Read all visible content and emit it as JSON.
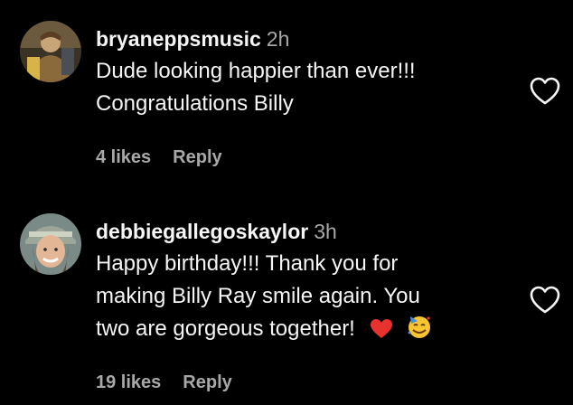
{
  "comments": [
    {
      "username": "bryaneppsmusic",
      "time": "2h",
      "lines": [
        "Dude looking happier than ever!!!",
        "Congratulations Billy"
      ],
      "likes": "4 likes",
      "reply": "Reply",
      "avatar_icon": "person-avatar-icon",
      "like_icon": "heart-outline-icon"
    },
    {
      "username": "debbiegallegoskaylor",
      "time": "3h",
      "lines": [
        "Happy birthday!!! Thank you for",
        "making Billy Ray smile again. You",
        "two are gorgeous together!"
      ],
      "emojis": [
        "red-heart-emoji",
        "partying-face-emoji"
      ],
      "likes": "19 likes",
      "reply": "Reply",
      "avatar_icon": "person-avatar-icon",
      "like_icon": "heart-outline-icon"
    }
  ],
  "colors": {
    "background": "#000000",
    "primary_text": "#f5f5f5",
    "secondary_text": "#a8a8a8",
    "heart_emoji": "#e8322d"
  }
}
